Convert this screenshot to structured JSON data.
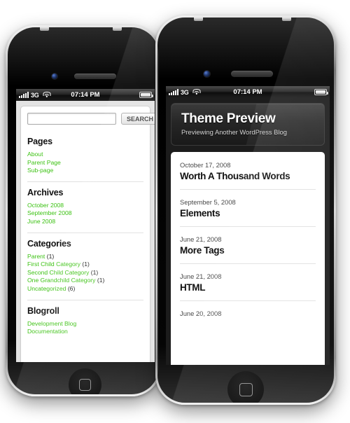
{
  "status_bar": {
    "signal_icon": "signal-bars-icon",
    "carrier": "3G",
    "wifi_icon": "wifi-icon",
    "time": "07:14 PM",
    "battery_icon": "battery-icon"
  },
  "left_phone": {
    "label": "iphone-sidebar-preview",
    "search": {
      "value": "",
      "placeholder": "",
      "button_label": "SEARCH"
    },
    "widgets": [
      {
        "title": "Pages",
        "items": [
          {
            "label": "About",
            "count": ""
          },
          {
            "label": "Parent Page",
            "count": ""
          },
          {
            "label": "Sub-page",
            "count": ""
          }
        ]
      },
      {
        "title": "Archives",
        "items": [
          {
            "label": "October 2008",
            "count": ""
          },
          {
            "label": "September 2008",
            "count": ""
          },
          {
            "label": "June 2008",
            "count": ""
          }
        ]
      },
      {
        "title": "Categories",
        "items": [
          {
            "label": "Parent",
            "count": "(1)"
          },
          {
            "label": "First Child Category",
            "count": "(1)"
          },
          {
            "label": "Second Child Category",
            "count": "(1)"
          },
          {
            "label": "One Grandchild Category",
            "count": "(1)"
          },
          {
            "label": "Uncategorized",
            "count": "(6)"
          }
        ]
      },
      {
        "title": "Blogroll",
        "items": [
          {
            "label": "Development Blog",
            "count": ""
          },
          {
            "label": "Documentation",
            "count": ""
          }
        ]
      }
    ]
  },
  "right_phone": {
    "label": "iphone-blog-preview",
    "header": {
      "title": "Theme Preview",
      "tagline": "Previewing Another WordPress Blog"
    },
    "posts": [
      {
        "date": "October 17, 2008",
        "title": "Worth A Thousand Words"
      },
      {
        "date": "September 5, 2008",
        "title": "Elements"
      },
      {
        "date": "June 21, 2008",
        "title": "More Tags"
      },
      {
        "date": "June 21, 2008",
        "title": "HTML"
      },
      {
        "date": "June 20, 2008",
        "title": ""
      }
    ]
  },
  "colors": {
    "link_green": "#3dc214",
    "page_background": "#ffffff",
    "device_body": "#d8d8d8",
    "screen_dark": "#1c1c1c"
  }
}
